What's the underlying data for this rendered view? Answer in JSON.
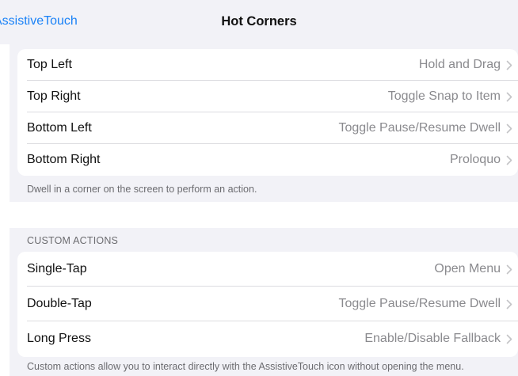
{
  "nav": {
    "back_label": "AssistiveTouch",
    "title": "Hot Corners"
  },
  "hot_corners": {
    "rows": [
      {
        "label": "Top Left",
        "value": "Hold and Drag"
      },
      {
        "label": "Top Right",
        "value": "Toggle Snap to Item"
      },
      {
        "label": "Bottom Left",
        "value": "Toggle Pause/Resume Dwell"
      },
      {
        "label": "Bottom Right",
        "value": "Proloquo"
      }
    ],
    "footer": "Dwell in a corner on the screen to perform an action."
  },
  "custom_actions": {
    "header": "CUSTOM ACTIONS",
    "rows": [
      {
        "label": "Single-Tap",
        "value": "Open Menu"
      },
      {
        "label": "Double-Tap",
        "value": "Toggle Pause/Resume Dwell"
      },
      {
        "label": "Long Press",
        "value": "Enable/Disable Fallback"
      }
    ],
    "footer": "Custom actions allow you to interact directly with the AssistiveTouch icon without opening the menu."
  },
  "icons": {
    "disclosure": "chevron-right-icon"
  },
  "colors": {
    "accent": "#1a82f7",
    "grouped_background": "#f2f2f7",
    "secondary_text": "#8a8a8e",
    "footer_text": "#6c6c70"
  }
}
